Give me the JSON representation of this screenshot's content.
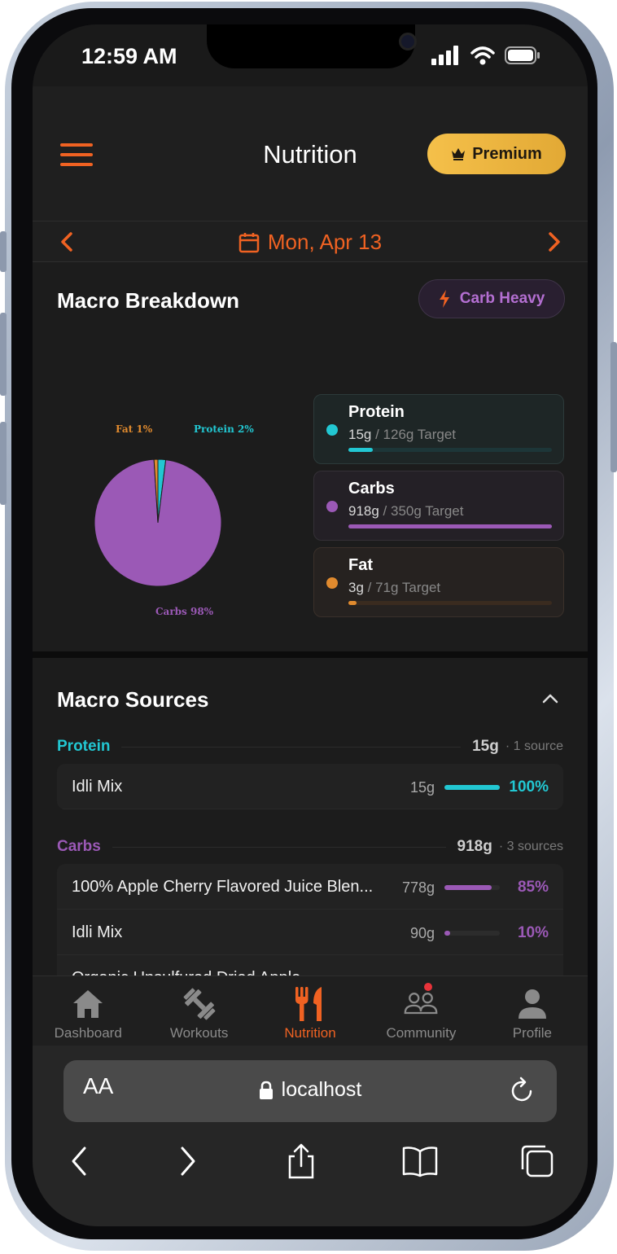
{
  "status_bar": {
    "time": "12:59 AM"
  },
  "header": {
    "title": "Nutrition",
    "premium_label": "Premium"
  },
  "date_nav": {
    "date": "Mon, Apr 13"
  },
  "macro_breakdown": {
    "title": "Macro Breakdown",
    "badge": "Carb Heavy",
    "macros": [
      {
        "name": "Protein",
        "value": "15g",
        "target": " / 126g Target",
        "color": "#22c7d2",
        "track": "#1d3638",
        "progress": 0.12,
        "box_bg": "#1e2626",
        "box_border": "#2c3a3a"
      },
      {
        "name": "Carbs",
        "value": "918g",
        "target": " / 350g Target",
        "color": "#9b59b6",
        "track": "#3a2a44",
        "progress": 1.0,
        "box_bg": "#242026",
        "box_border": "#343036"
      },
      {
        "name": "Fat",
        "value": "3g",
        "target": " / 71g Target",
        "color": "#e08a2e",
        "track": "#3a2b1f",
        "progress": 0.04,
        "box_bg": "#262220",
        "box_border": "#3a302a"
      }
    ]
  },
  "chart_data": {
    "type": "pie",
    "title": "",
    "slices": [
      {
        "label": "Carbs 98%",
        "value": 98,
        "color": "#9b59b6"
      },
      {
        "label": "Fat 1%",
        "value": 1,
        "color": "#e08a2e"
      },
      {
        "label": "Protein 2%",
        "value": 2,
        "color": "#22c7d2"
      }
    ]
  },
  "macro_sources": {
    "title": "Macro Sources",
    "groups": [
      {
        "name": "Protein",
        "color": "#22c7d2",
        "total": "15g",
        "count": "· 1 source",
        "items": [
          {
            "name": "Idli Mix",
            "grams": "15g",
            "pct": "100%",
            "fraction": 1.0
          }
        ]
      },
      {
        "name": "Carbs",
        "color": "#9b59b6",
        "total": "918g",
        "count": "· 3 sources",
        "items": [
          {
            "name": "100% Apple Cherry Flavored Juice Blen...",
            "grams": "778g",
            "pct": "85%",
            "fraction": 0.85
          },
          {
            "name": "Idli Mix",
            "grams": "90g",
            "pct": "10%",
            "fraction": 0.1
          },
          {
            "name": "Organic Unsulfured Dried Apple",
            "grams": "",
            "pct": "",
            "fraction": 0.05
          }
        ]
      }
    ]
  },
  "bottom_nav": {
    "items": [
      {
        "label": "Dashboard",
        "icon": "home-icon"
      },
      {
        "label": "Workouts",
        "icon": "dumbbell-icon"
      },
      {
        "label": "Nutrition",
        "icon": "fork-knife-icon",
        "active": true
      },
      {
        "label": "Community",
        "icon": "community-icon"
      },
      {
        "label": "Profile",
        "icon": "person-icon"
      }
    ],
    "active_color": "#f06222"
  },
  "browser": {
    "text_size": "AA",
    "url": "localhost"
  }
}
